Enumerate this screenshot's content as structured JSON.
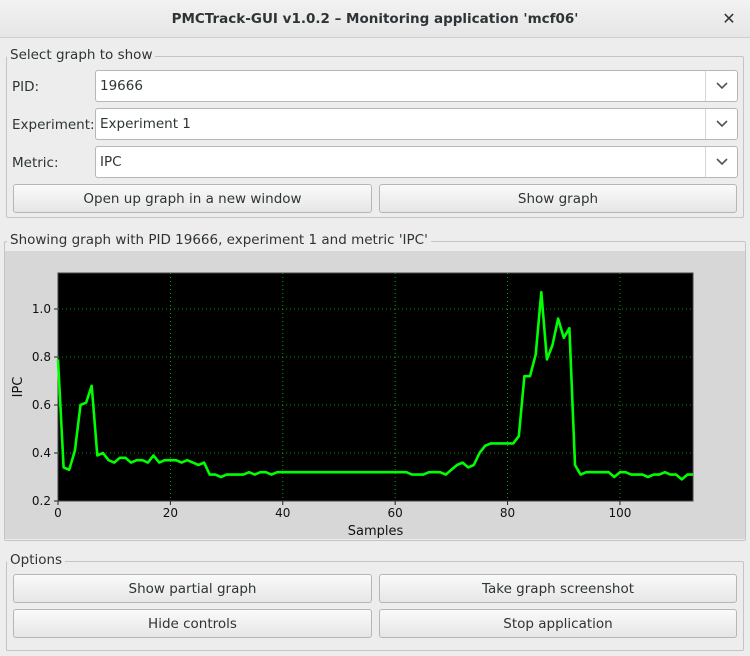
{
  "window": {
    "title": "PMCTrack-GUI v1.0.2 – Monitoring application 'mcf06'",
    "close_icon": "close-icon"
  },
  "select_group": {
    "label": "Select graph to show",
    "pid_label": "PID:",
    "pid_value": "19666",
    "experiment_label": "Experiment:",
    "experiment_value": "Experiment 1",
    "metric_label": "Metric:",
    "metric_value": "IPC",
    "open_window_button": "Open up graph in a new window",
    "show_graph_button": "Show graph"
  },
  "graph_group": {
    "label": "Showing graph with PID 19666, experiment 1 and metric 'IPC'"
  },
  "options_group": {
    "label": "Options",
    "show_partial_button": "Show partial graph",
    "screenshot_button": "Take graph screenshot",
    "hide_controls_button": "Hide controls",
    "stop_button": "Stop application"
  },
  "colors": {
    "plot_background": "#000000",
    "line": "#00ff00",
    "grid": "#00cc00"
  },
  "chart_data": {
    "type": "line",
    "xlabel": "Samples",
    "ylabel": "IPC",
    "xlim": [
      0,
      113
    ],
    "ylim": [
      0.2,
      1.15
    ],
    "xticks": [
      0,
      20,
      40,
      60,
      80,
      100
    ],
    "yticks": [
      0.2,
      0.4,
      0.6,
      0.8,
      1.0
    ],
    "grid": true,
    "series": [
      {
        "values": [
          0.79,
          0.34,
          0.33,
          0.41,
          0.6,
          0.61,
          0.68,
          0.39,
          0.4,
          0.37,
          0.36,
          0.38,
          0.38,
          0.36,
          0.37,
          0.37,
          0.36,
          0.39,
          0.36,
          0.37,
          0.37,
          0.37,
          0.36,
          0.37,
          0.36,
          0.35,
          0.36,
          0.31,
          0.31,
          0.3,
          0.31,
          0.31,
          0.31,
          0.31,
          0.32,
          0.31,
          0.32,
          0.32,
          0.31,
          0.32,
          0.32,
          0.32,
          0.32,
          0.32,
          0.32,
          0.32,
          0.32,
          0.32,
          0.32,
          0.32,
          0.32,
          0.32,
          0.32,
          0.32,
          0.32,
          0.32,
          0.32,
          0.32,
          0.32,
          0.32,
          0.32,
          0.32,
          0.32,
          0.31,
          0.31,
          0.31,
          0.32,
          0.32,
          0.32,
          0.31,
          0.33,
          0.35,
          0.36,
          0.34,
          0.35,
          0.4,
          0.43,
          0.44,
          0.44,
          0.44,
          0.44,
          0.44,
          0.47,
          0.72,
          0.72,
          0.81,
          1.07,
          0.79,
          0.85,
          0.96,
          0.88,
          0.92,
          0.35,
          0.31,
          0.32,
          0.32,
          0.32,
          0.32,
          0.32,
          0.3,
          0.32,
          0.32,
          0.31,
          0.31,
          0.31,
          0.3,
          0.31,
          0.31,
          0.32,
          0.31,
          0.31,
          0.29,
          0.31,
          0.31
        ]
      }
    ]
  }
}
